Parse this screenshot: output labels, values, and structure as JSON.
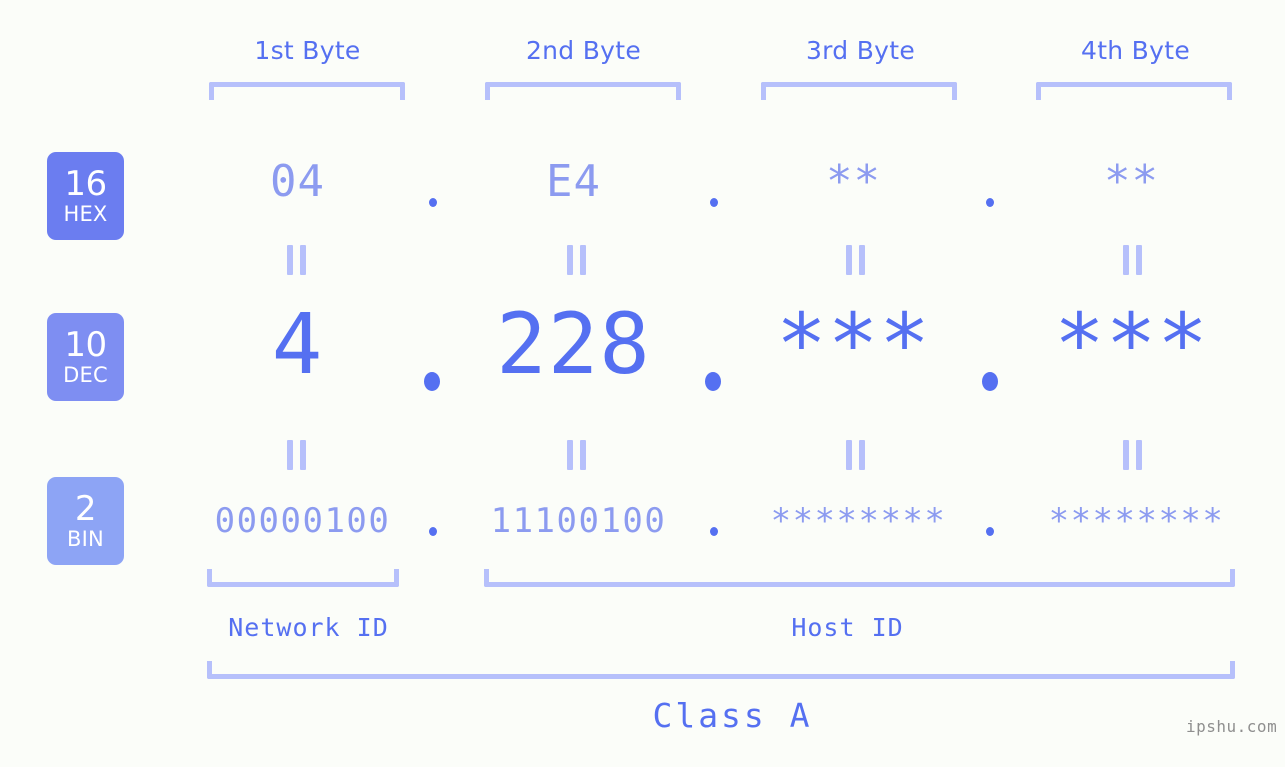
{
  "background_color": "#fbfdf9",
  "accent_color": "#5570f1",
  "accent_light_color": "#8c9bf0",
  "bracket_color": "#b6c0fb",
  "byte_headers": [
    {
      "label": "1st Byte"
    },
    {
      "label": "2nd Byte"
    },
    {
      "label": "3rd Byte"
    },
    {
      "label": "4th Byte"
    }
  ],
  "rows": {
    "hex": {
      "badge_number": "16",
      "badge_word": "HEX",
      "badge_color": "#6b7df0",
      "values": [
        "04",
        "E4",
        "**",
        "**"
      ],
      "separator": "."
    },
    "dec": {
      "badge_number": "10",
      "badge_word": "DEC",
      "badge_color": "#7e8ef2",
      "values": [
        "4",
        "228",
        "***",
        "***"
      ],
      "separator": "."
    },
    "bin": {
      "badge_number": "2",
      "badge_word": "BIN",
      "badge_color": "#8da4f5",
      "values": [
        "00000100",
        "11100100",
        "********",
        "********"
      ],
      "separator": "."
    }
  },
  "segments": {
    "network_id": "Network ID",
    "host_id": "Host ID",
    "class": "Class A"
  },
  "watermark": "ipshu.com"
}
